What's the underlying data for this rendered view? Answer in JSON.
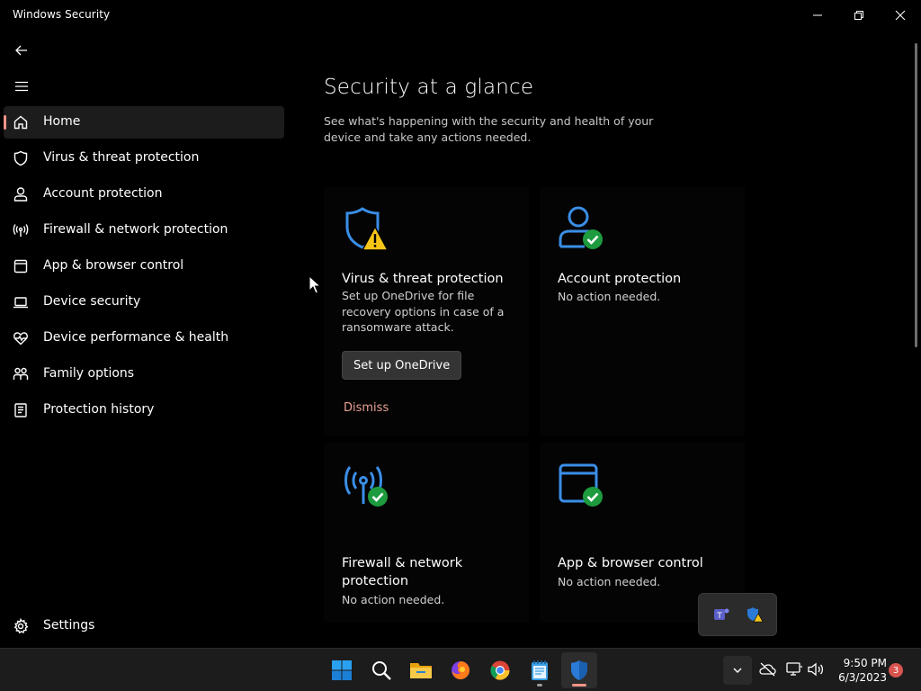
{
  "window": {
    "title": "Windows Security"
  },
  "sidebar": {
    "items": [
      {
        "label": "Home",
        "icon": "home-icon",
        "active": true
      },
      {
        "label": "Virus & threat protection",
        "icon": "shield-icon"
      },
      {
        "label": "Account protection",
        "icon": "person-icon"
      },
      {
        "label": "Firewall & network protection",
        "icon": "antenna-icon"
      },
      {
        "label": "App & browser control",
        "icon": "browser-window-icon"
      },
      {
        "label": "Device security",
        "icon": "laptop-icon"
      },
      {
        "label": "Device performance & health",
        "icon": "heart-pulse-icon"
      },
      {
        "label": "Family options",
        "icon": "family-icon"
      },
      {
        "label": "Protection history",
        "icon": "history-icon"
      }
    ],
    "settings_label": "Settings"
  },
  "main": {
    "title": "Security at a glance",
    "subtitle": "See what's happening with the security and health of your device and take any actions needed.",
    "cards": [
      {
        "title": "Virus & threat protection",
        "text": "Set up OneDrive for file recovery options in case of a ransomware attack.",
        "button": "Set up OneDrive",
        "link": "Dismiss",
        "status": "warning"
      },
      {
        "title": "Account protection",
        "text": "No action needed.",
        "status": "ok"
      },
      {
        "title": "Firewall & network protection",
        "text": "No action needed.",
        "status": "ok"
      },
      {
        "title": "App & browser control",
        "text": "No action needed.",
        "status": "ok"
      }
    ]
  },
  "taskbar": {
    "apps": [
      "start-icon",
      "search-icon",
      "file-explorer-icon",
      "firefox-icon",
      "chrome-icon",
      "notepad-icon",
      "windows-security-icon"
    ],
    "time": "9:50 PM",
    "date": "6/3/2023",
    "notification_count": "3"
  },
  "colors": {
    "accent_blue": "#3a8ee6",
    "ok_green": "#1d9b3e",
    "warning_yellow": "#f5c518",
    "active_indicator": "#f29488",
    "dismiss_link": "#e8a093"
  }
}
